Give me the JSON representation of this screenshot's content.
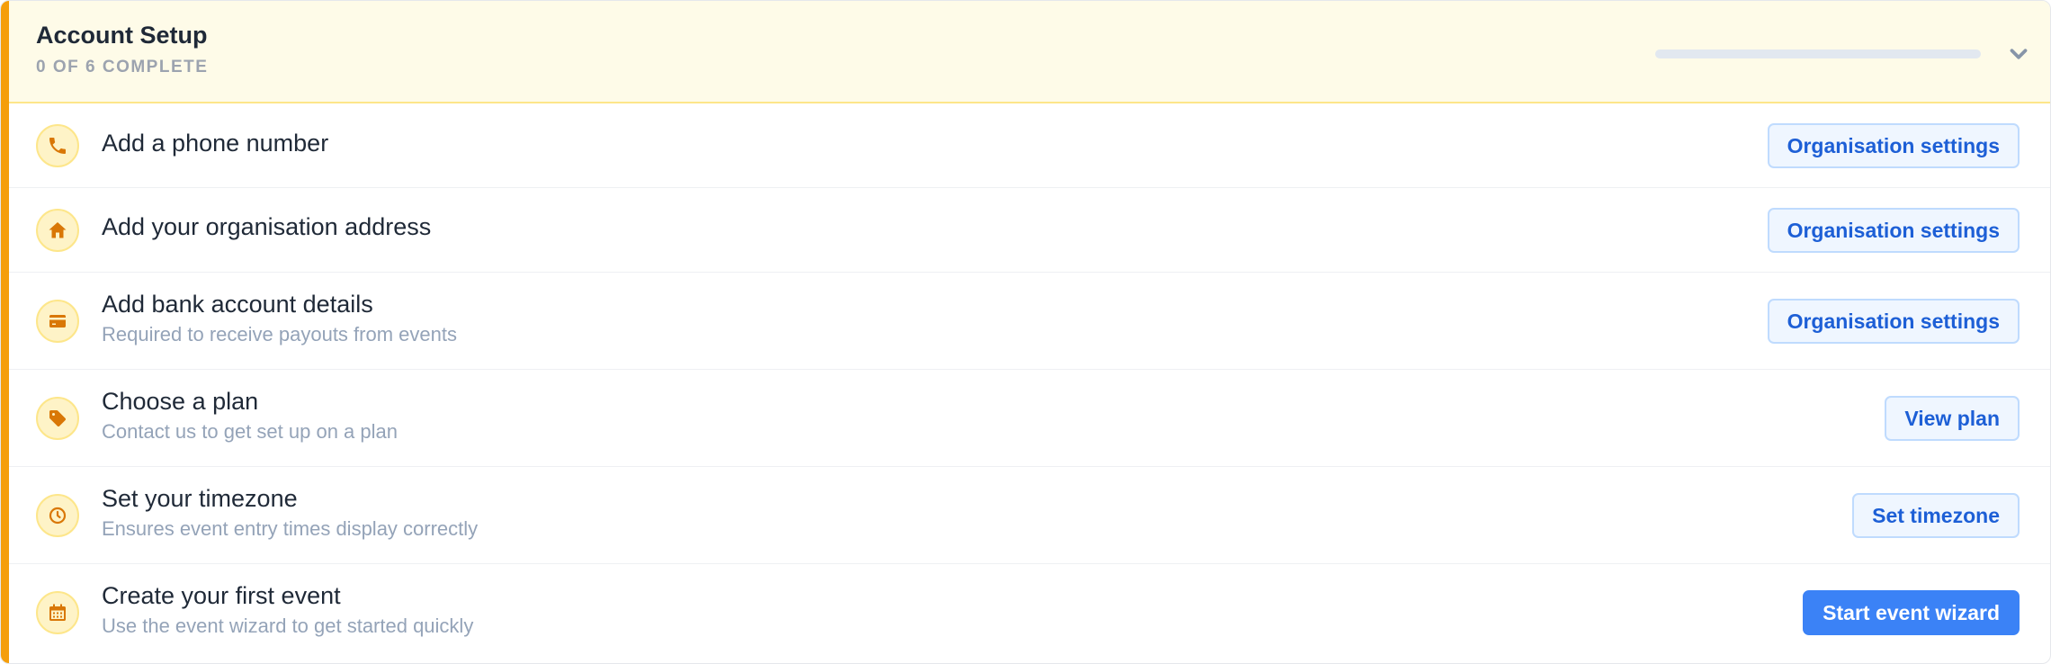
{
  "header": {
    "title": "Account Setup",
    "subtitle": "0 OF 6 COMPLETE",
    "progress_fraction": 0,
    "collapse_icon": "chevron-down-icon"
  },
  "colors": {
    "accent": "#f59e0b",
    "header_bg": "#fefbe8",
    "icon_bg": "#fef3c7",
    "icon_color": "#d97706",
    "primary_button": "#3b82f6",
    "secondary_button_text": "#1d5fd6"
  },
  "tasks": [
    {
      "icon": "phone-icon",
      "title": "Add a phone number",
      "description": "",
      "action_label": "Organisation settings",
      "action_style": "secondary"
    },
    {
      "icon": "home-icon",
      "title": "Add your organisation address",
      "description": "",
      "action_label": "Organisation settings",
      "action_style": "secondary"
    },
    {
      "icon": "credit-card-icon",
      "title": "Add bank account details",
      "description": "Required to receive payouts from events",
      "action_label": "Organisation settings",
      "action_style": "secondary"
    },
    {
      "icon": "tag-icon",
      "title": "Choose a plan",
      "description": "Contact us to get set up on a plan",
      "action_label": "View plan",
      "action_style": "secondary"
    },
    {
      "icon": "clock-icon",
      "title": "Set your timezone",
      "description": "Ensures event entry times display correctly",
      "action_label": "Set timezone",
      "action_style": "secondary"
    },
    {
      "icon": "calendar-icon",
      "title": "Create your first event",
      "description": "Use the event wizard to get started quickly",
      "action_label": "Start event wizard",
      "action_style": "primary"
    }
  ]
}
